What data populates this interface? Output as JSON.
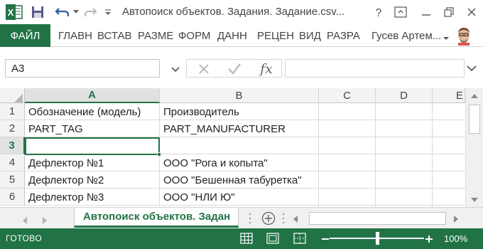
{
  "window": {
    "title": "Автопоиск объектов. Задания. Задание.csv..."
  },
  "ribbon": {
    "file_tab": "ФАЙЛ",
    "tabs": [
      "ГЛАВН",
      "ВСТАВ",
      "РАЗМЕ",
      "ФОРМ",
      "ДАНН",
      "РЕЦЕН",
      "ВИД",
      "РАЗРА"
    ],
    "user_name": "Гусев Артем..."
  },
  "formula_bar": {
    "name_box": "A3",
    "fx_label": "fx",
    "formula_value": ""
  },
  "grid": {
    "columns": [
      "A",
      "B",
      "C",
      "D",
      "E"
    ],
    "active_column": "A",
    "rows": [
      {
        "num": "1",
        "a": "Обозначение (модель)",
        "b": "Производитель"
      },
      {
        "num": "2",
        "a": "PART_TAG",
        "b": "PART_MANUFACTURER"
      },
      {
        "num": "3",
        "a": "",
        "b": ""
      },
      {
        "num": "4",
        "a": "Дефлектор №1",
        "b": "ООО \"Рога и копыта\""
      },
      {
        "num": "5",
        "a": "Дефлектор №2",
        "b": "ООО \"Бешенная табуретка\""
      },
      {
        "num": "6",
        "a": "Дефлектор №3",
        "b": "ООО \"НЛИ Ю\""
      }
    ],
    "active_row": "3"
  },
  "sheets": {
    "active_tab": "Автопоиск объектов. Задан"
  },
  "status": {
    "ready": "ГОТОВО",
    "zoom": "100%",
    "zoom_fraction": 0.5
  },
  "colors": {
    "accent": "#217346",
    "status_bar": "#217346"
  },
  "icons": {
    "app": "excel-logo-icon",
    "save": "save-icon",
    "undo": "undo-icon",
    "redo": "redo-icon",
    "help": "help-icon",
    "ribbon_display": "ribbon-display-icon",
    "minimize": "minimize-icon",
    "restore": "restore-icon",
    "close": "close-icon"
  }
}
